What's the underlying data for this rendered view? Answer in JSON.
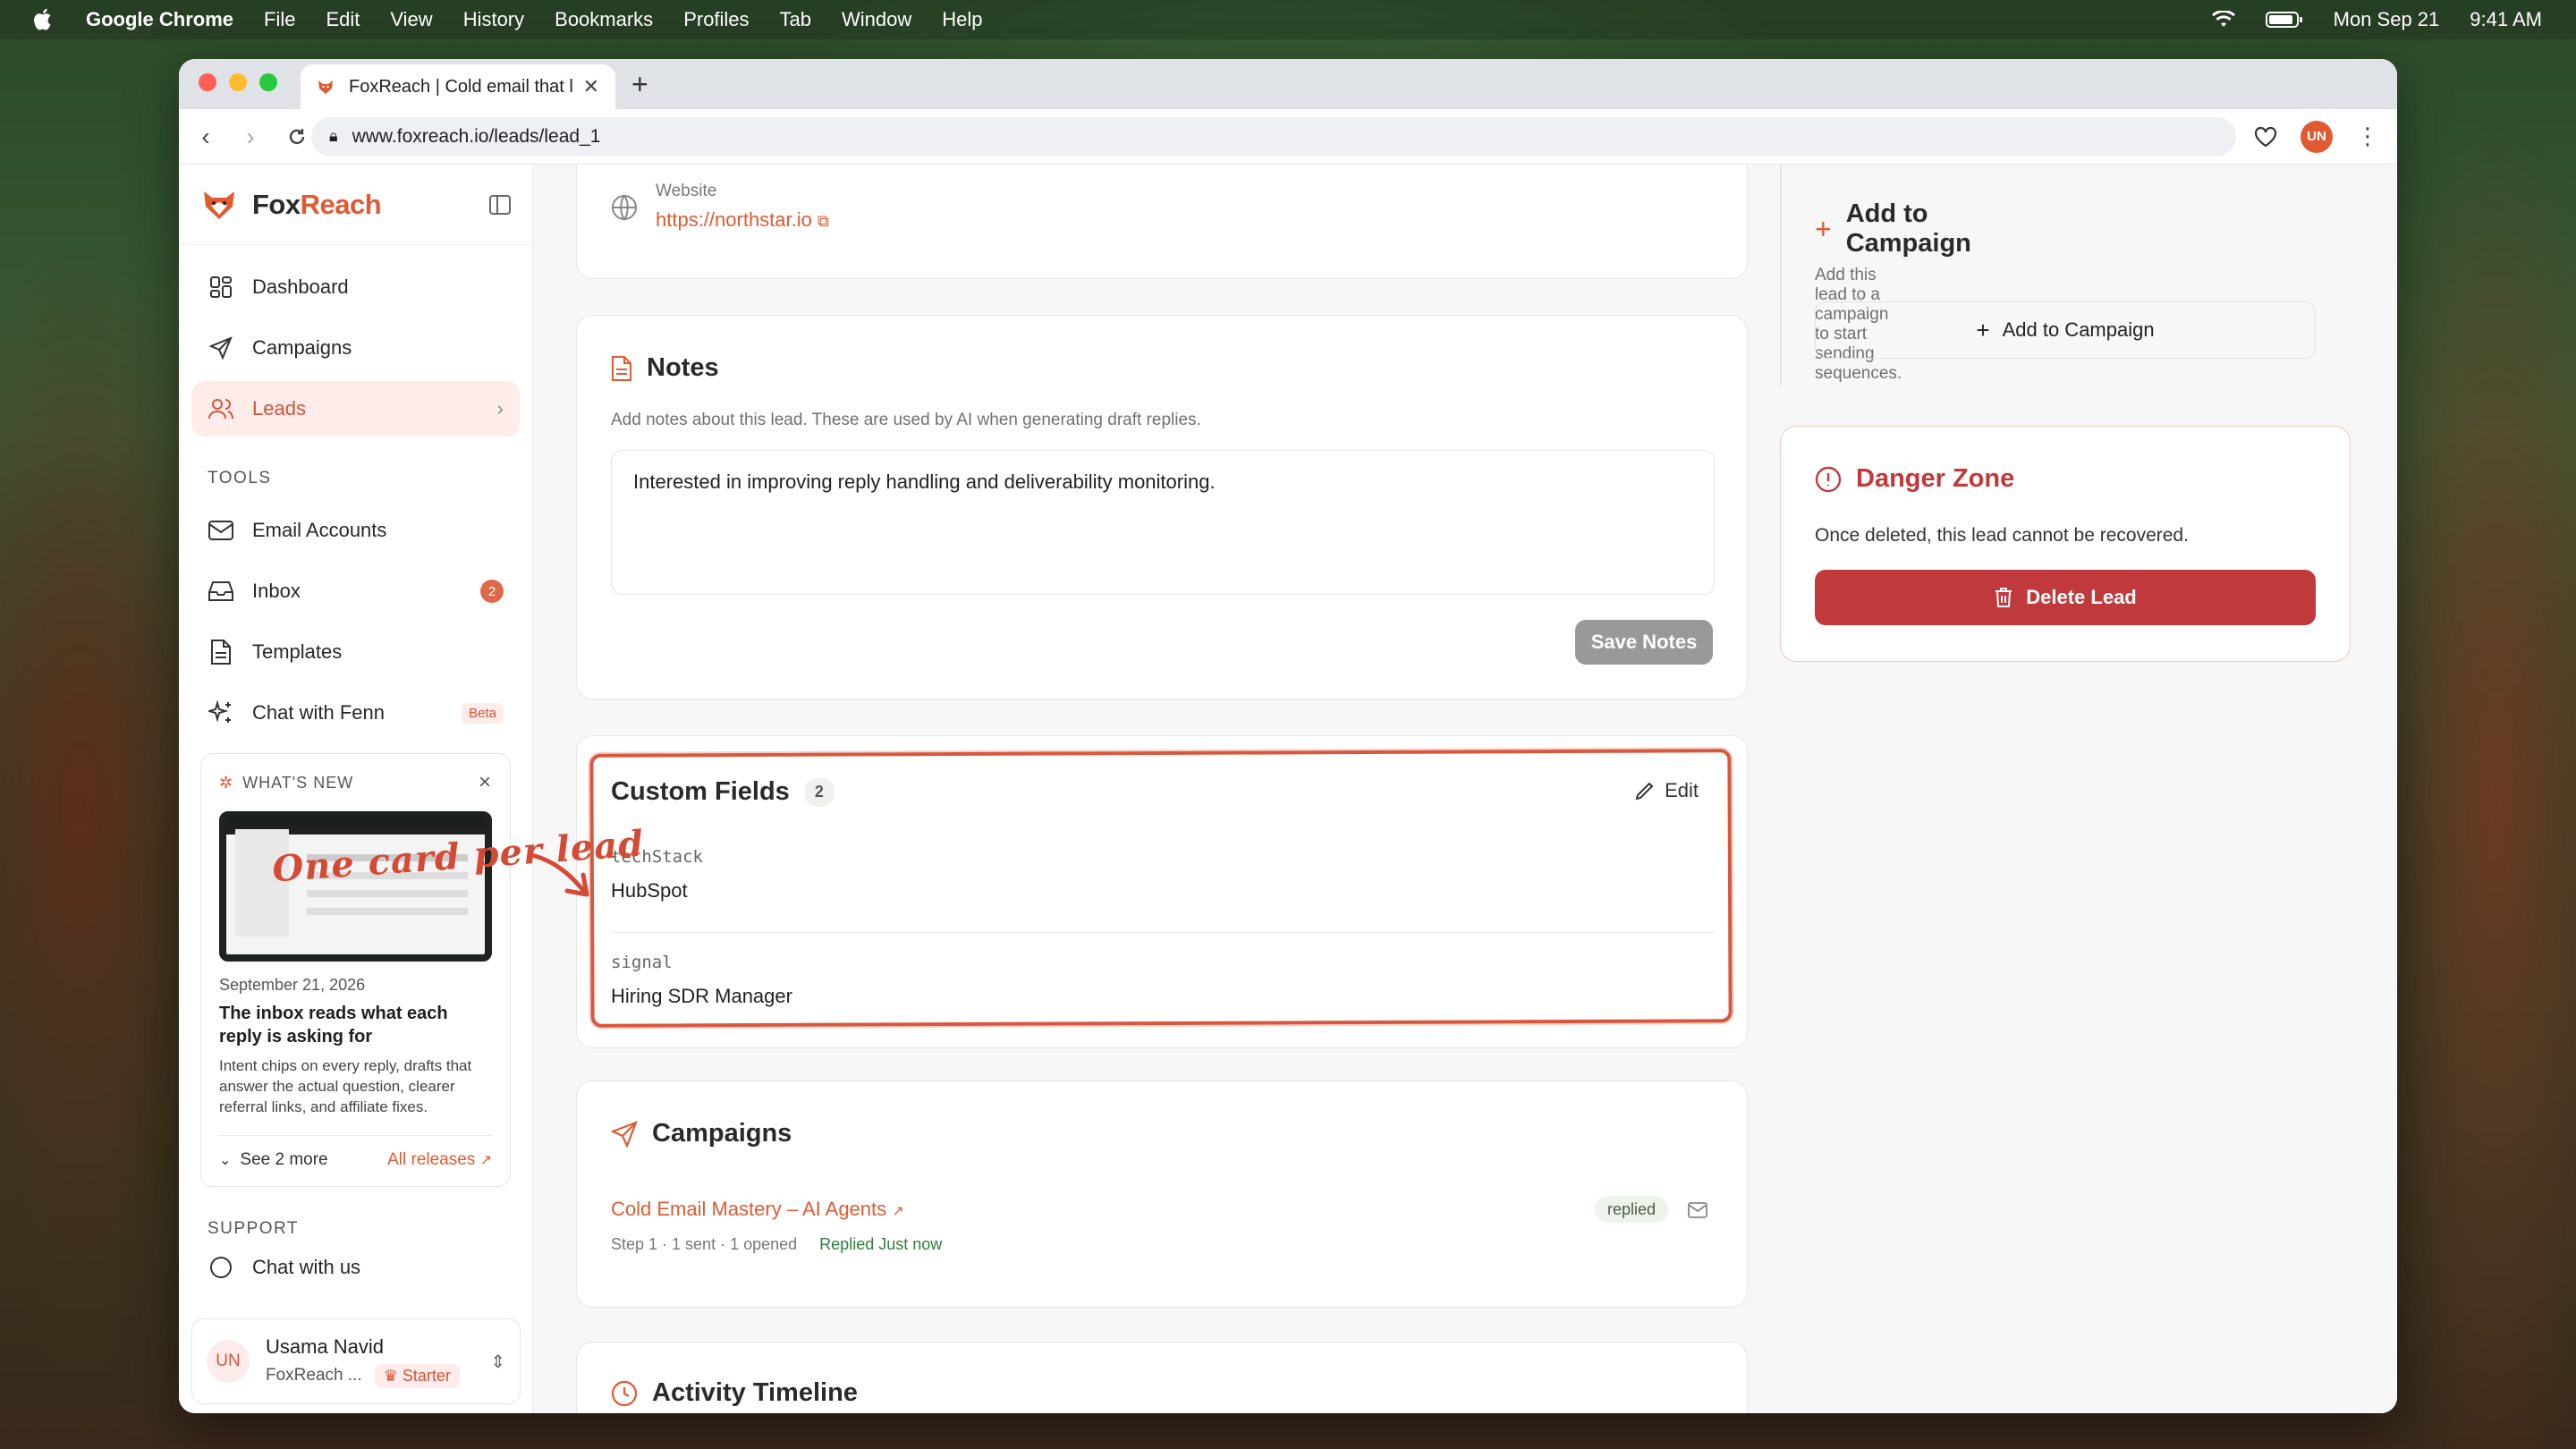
{
  "menubar": {
    "app": "Google Chrome",
    "items": [
      "File",
      "Edit",
      "View",
      "History",
      "Bookmarks",
      "Profiles",
      "Tab",
      "Window",
      "Help"
    ],
    "date": "Mon Sep 21",
    "time": "9:41 AM"
  },
  "browser": {
    "tab_title": "FoxReach | Cold email that l...",
    "url": "www.foxreach.io/leads/lead_1",
    "profile_initials": "UN"
  },
  "sidebar": {
    "brand_first": "Fox",
    "brand_second": "Reach",
    "nav": [
      {
        "label": "Dashboard",
        "icon": "dashboard-icon"
      },
      {
        "label": "Campaigns",
        "icon": "send-icon"
      },
      {
        "label": "Leads",
        "icon": "users-icon"
      }
    ],
    "tools_heading": "TOOLS",
    "tools": [
      {
        "label": "Email Accounts",
        "icon": "mail-icon"
      },
      {
        "label": "Inbox",
        "icon": "inbox-icon",
        "badge": "2"
      },
      {
        "label": "Templates",
        "icon": "document-icon"
      },
      {
        "label": "Chat with Fenn",
        "icon": "sparkles-icon",
        "tag": "Beta"
      }
    ],
    "whats_new": {
      "heading": "WHAT'S NEW",
      "date": "September 21, 2026",
      "title": "The inbox reads what each reply is asking for",
      "desc": "Intent chips on every reply, drafts that answer the actual question, clearer referral links, and affiliate fixes.",
      "see_more": "See 2 more",
      "all_releases": "All releases"
    },
    "support_heading": "SUPPORT",
    "support_item": "Chat with us",
    "user": {
      "initials": "UN",
      "name": "Usama Navid",
      "org": "FoxReach ...",
      "plan": "Starter"
    }
  },
  "main": {
    "website": {
      "label": "Website",
      "url": "https://northstar.io"
    },
    "notes": {
      "title": "Notes",
      "help": "Add notes about this lead. These are used by AI when generating draft replies.",
      "value": "Interested in improving reply handling and deliverability monitoring.",
      "save": "Save Notes"
    },
    "custom_fields": {
      "title": "Custom Fields",
      "count": "2",
      "edit": "Edit",
      "fields": [
        {
          "key": "techStack",
          "value": "HubSpot"
        },
        {
          "key": "signal",
          "value": "Hiring SDR Manager"
        }
      ]
    },
    "annotation": "One card per lead",
    "campaigns": {
      "title": "Campaigns",
      "item": {
        "name": "Cold Email Mastery – AI Agents",
        "status": "replied",
        "meta": "Step 1 · 1 sent · 1 opened",
        "replied": "Replied Just now"
      }
    },
    "activity": {
      "title": "Activity Timeline"
    }
  },
  "right": {
    "add_campaign": {
      "title": "Add to Campaign",
      "help": "Add this lead to a campaign to start sending sequences.",
      "button": "Add to Campaign"
    },
    "danger": {
      "title": "Danger Zone",
      "text": "Once deleted, this lead cannot be recovered.",
      "button": "Delete Lead"
    }
  },
  "colors": {
    "accent": "#e05a32",
    "danger": "#c0393b",
    "success": "#2f7d3d"
  }
}
